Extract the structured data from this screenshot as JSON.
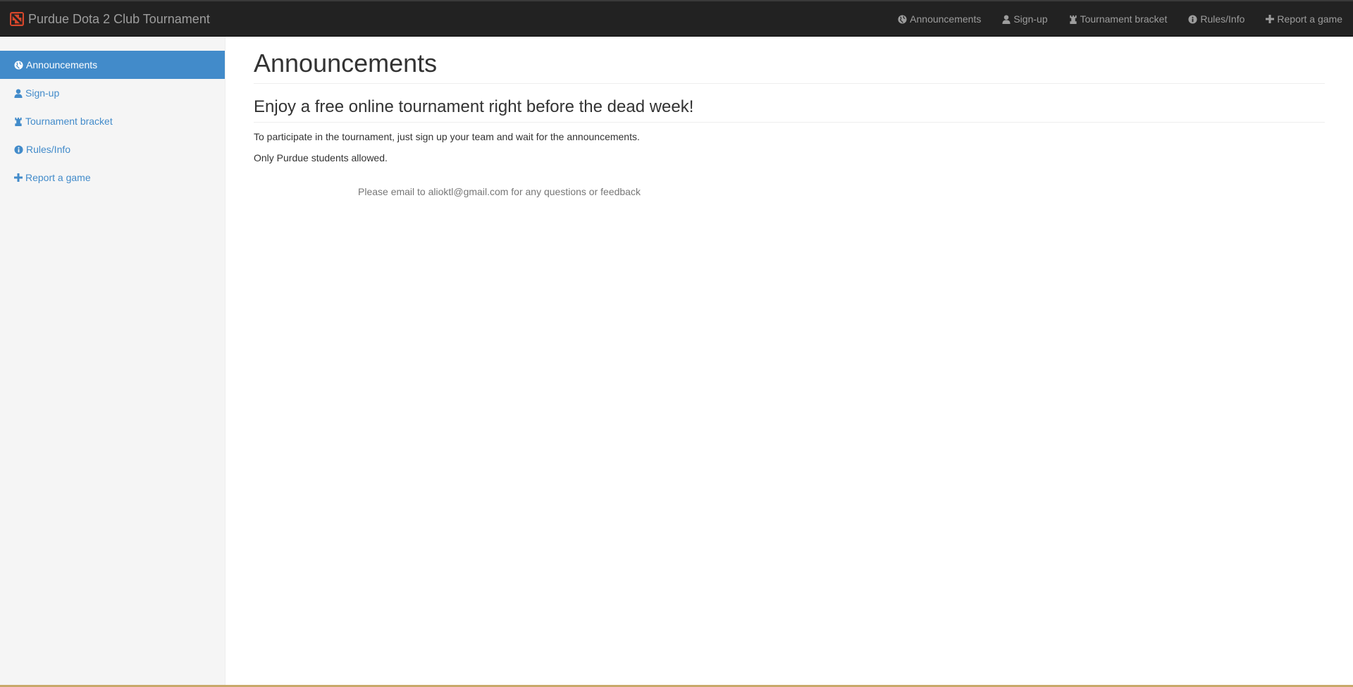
{
  "brand": {
    "title": "Purdue Dota 2 Club Tournament",
    "logo_icon": "dota-logo-icon",
    "logo_color": "#d9472b"
  },
  "topnav": {
    "items": [
      {
        "label": "Announcements",
        "icon": "globe-icon"
      },
      {
        "label": "Sign-up",
        "icon": "user-icon"
      },
      {
        "label": "Tournament bracket",
        "icon": "tower-icon"
      },
      {
        "label": "Rules/Info",
        "icon": "info-icon"
      },
      {
        "label": "Report a game",
        "icon": "plus-icon"
      }
    ]
  },
  "sidebar": {
    "items": [
      {
        "label": "Announcements",
        "icon": "globe-icon",
        "active": true
      },
      {
        "label": "Sign-up",
        "icon": "user-icon",
        "active": false
      },
      {
        "label": "Tournament bracket",
        "icon": "tower-icon",
        "active": false
      },
      {
        "label": "Rules/Info",
        "icon": "info-icon",
        "active": false
      },
      {
        "label": "Report a game",
        "icon": "plus-icon",
        "active": false
      }
    ]
  },
  "main": {
    "page_title": "Announcements",
    "sub_title": "Enjoy a free online tournament right before the dead week!",
    "paragraphs": [
      "To participate in the tournament, just sign up your team and wait for the announcements.",
      "Only Purdue students allowed."
    ],
    "footer_note": "Please email to alioktl@gmail.com for any questions or feedback"
  },
  "colors": {
    "navbar_bg": "#222222",
    "link": "#428bca",
    "active_bg": "#428bca",
    "sidebar_bg": "#f5f5f5"
  }
}
